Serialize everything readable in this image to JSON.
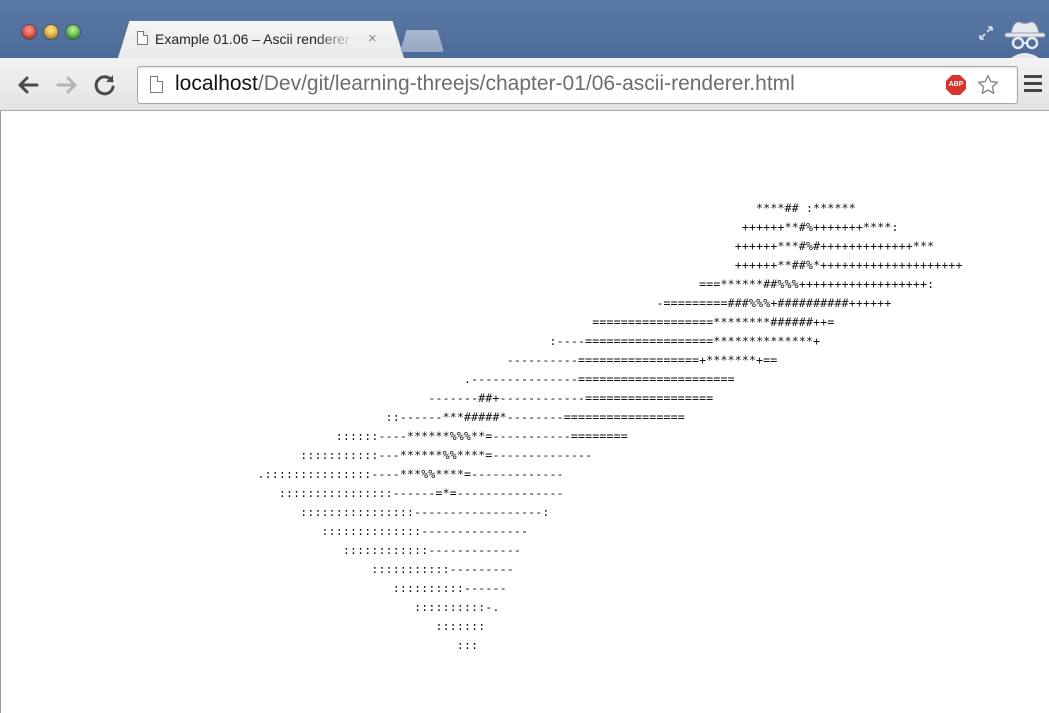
{
  "window": {
    "tab_title": "Example 01.06 – Ascii renderer",
    "tab_close": "×"
  },
  "toolbar": {
    "url_host": "localhost",
    "url_path": "/Dev/git/learning-threejs/chapter-01/06-ascii-renderer.html",
    "extension_badge": "ABP"
  },
  "icons": {
    "back": "back-arrow-icon",
    "forward": "forward-arrow-icon",
    "reload": "reload-icon",
    "page": "page-icon",
    "star": "bookmark-star-icon",
    "menu": "menu-icon",
    "expand": "expand-icon",
    "incognito": "incognito-icon"
  },
  "content": {
    "ascii_lines": [
      "                                                                                                          ****## :******",
      "                                                                                                        ++++++**#%+++++++****:",
      "                                                                                                       ++++++***#%#+++++++++++++***",
      "                                                                                                       ++++++**##%*++++++++++++++++++++",
      "                                                                                                  ===******##%%%++++++++++++++++++:",
      "                                                                                            -=========###%%%+##########++++++",
      "                                                                                   =================********######++=",
      "                                                                             :----==================**************+",
      "                                                                       ----------=================+*******+==",
      "                                                                 .---------------======================",
      "                                                            -------##+------------==================",
      "                                                      ::------***#####*--------=================",
      "                                               ::::::----******%%%**=-----------========",
      "                                          :::::::::::---******%%****=--------------",
      "                                    .:::::::::::::::----***%%****=-------------",
      "                                       ::::::::::::::::------=*=---------------",
      "                                          ::::::::::::::::------------------:",
      "                                             ::::::::::::::---------------",
      "                                                ::::::::::::-------------",
      "                                                    :::::::::::---------",
      "                                                       ::::::::::------",
      "                                                          ::::::::::-.",
      "                                                             :::::::",
      "                                                                :::"
    ]
  }
}
